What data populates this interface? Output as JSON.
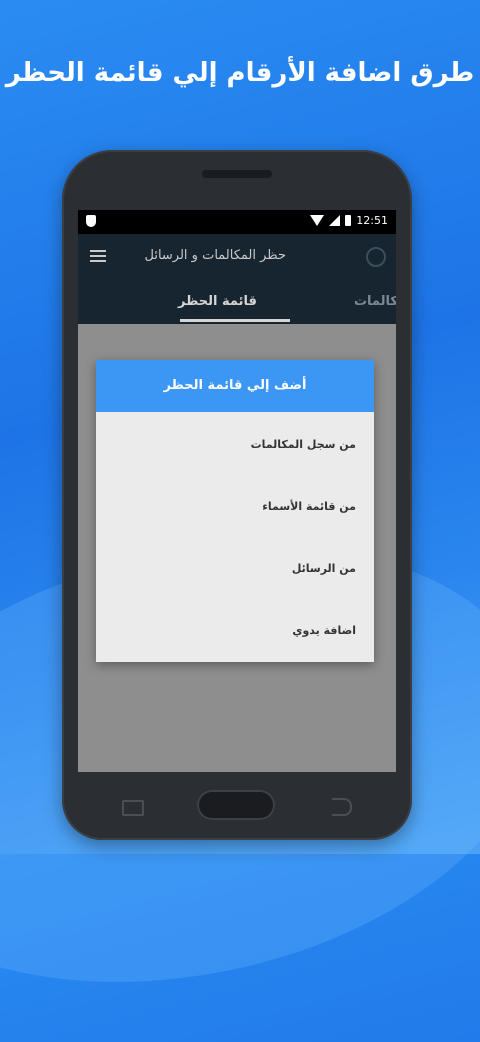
{
  "headline": "طرق اضافة الأرقام إلي قائمة الحظر",
  "status_bar": {
    "time": "12:51",
    "icons": [
      "shield-icon",
      "wifi-icon",
      "signal-icon",
      "battery-icon"
    ]
  },
  "app_bar": {
    "title": "حظر المكالمات و الرسائل",
    "icons": [
      "menu-icon",
      "refresh-icon"
    ]
  },
  "tabs": [
    {
      "label": "قائمة الحظر",
      "active": true
    },
    {
      "label": "المكالمات",
      "active": false
    }
  ],
  "dialog": {
    "title": "أضف إلي قائمة الحظر",
    "options": [
      {
        "label": "من سجل المكالمات"
      },
      {
        "label": "من قائمة الأسماء"
      },
      {
        "label": "من الرسائل"
      },
      {
        "label": "اضافة يدوي"
      }
    ]
  },
  "fab": {
    "label": "+"
  },
  "colors": {
    "background": "#1e74e6",
    "app_bar": "#16252f",
    "dialog_header": "#3b97f3",
    "fab": "#173a63"
  }
}
